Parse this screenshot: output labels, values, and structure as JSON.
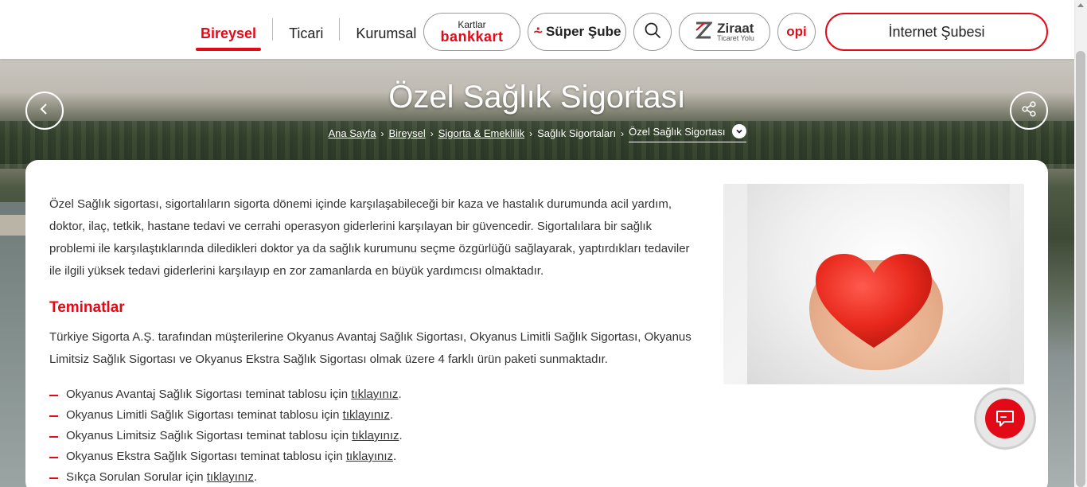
{
  "header": {
    "nav": [
      {
        "label": "Bireysel",
        "active": true
      },
      {
        "label": "Ticari",
        "active": false
      },
      {
        "label": "Kurumsal",
        "active": false
      }
    ],
    "bankkart_small": "Kartlar",
    "bankkart_brand": "bankkart",
    "super_sube": "Süper Şube",
    "ziraat_name": "Ziraat",
    "ziraat_sub": "Ticaret Yolu",
    "opi_label": "opi",
    "internet_subesi": "İnternet Şubesi",
    "accent_color": "#e30a17"
  },
  "hero": {
    "title": "Özel Sağlık Sigortası",
    "breadcrumb": [
      "Ana Sayfa",
      "Bireysel",
      "Sigorta & Emeklilik",
      "Sağlık Sigortaları",
      "Özel Sağlık Sigortası"
    ]
  },
  "content": {
    "intro": "Özel Sağlık sigortası, sigortalıların sigorta dönemi içinde karşılaşabileceği bir kaza ve hastalık durumunda acil yardım, doktor, ilaç, tetkik, hastane tedavi ve cerrahi operasyon giderlerini karşılayan bir güvencedir. Sigortalılara bir sağlık problemi ile karşılaştıklarında diledikleri doktor ya da sağlık kurumunu seçme özgürlüğü sağlayarak, yaptırdıkları tedaviler ile ilgili yüksek tedavi giderlerini karşılayıp en zor zamanlarda en büyük yardımcısı olmaktadır.",
    "section_title": "Teminatlar",
    "para2": "Türkiye Sigorta A.Ş. tarafından müşterilerine Okyanus Avantaj Sağlık Sigortası, Okyanus Limitli Sağlık Sigortası, Okyanus Limitsiz Sağlık Sigortası ve Okyanus Ekstra Sağlık Sigortası olmak üzere 4 farklı ürün paketi sunmaktadır.",
    "list": [
      {
        "text": "Okyanus Avantaj Sağlık Sigortası teminat tablosu için ",
        "link": "tıklayınız",
        "end": "."
      },
      {
        "text": "Okyanus Limitli Sağlık Sigortası teminat tablosu için ",
        "link": "tıklayınız",
        "end": "."
      },
      {
        "text": "Okyanus Limitsiz Sağlık Sigortası teminat tablosu için ",
        "link": "tıklayınız",
        "end": "."
      },
      {
        "text": "Okyanus Ekstra Sağlık Sigortası teminat tablosu için ",
        "link": "tıklayınız",
        "end": "."
      },
      {
        "text": "Sıkça Sorulan Sorular için ",
        "link": "tıklayınız",
        "end": "."
      }
    ]
  }
}
